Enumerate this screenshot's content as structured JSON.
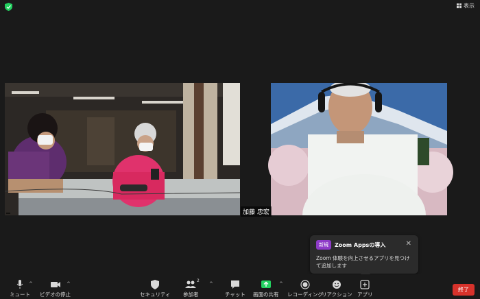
{
  "header": {
    "view_label": "表示"
  },
  "participants": {
    "left_name": "",
    "right_name": "加藤 忠宏"
  },
  "popup": {
    "badge": "新規",
    "title": "Zoom Appsの導入",
    "body": "Zoom 体験を向上させるアプリを見つけて追加します"
  },
  "toolbar": {
    "mute_label": "ミュート",
    "video_label": "ビデオの停止",
    "security_label": "セキュリティ",
    "participants_label": "参加者",
    "participants_count": "2",
    "chat_label": "チャット",
    "share_label": "画面の共有",
    "record_label": "レコーディング",
    "reaction_label": "リアクション",
    "apps_label": "アプリ",
    "end_label": "終了"
  },
  "colors": {
    "shield": "#23d160",
    "share_green": "#23d160",
    "end_red": "#d7322b",
    "badge_purple": "#8e3bc8"
  }
}
